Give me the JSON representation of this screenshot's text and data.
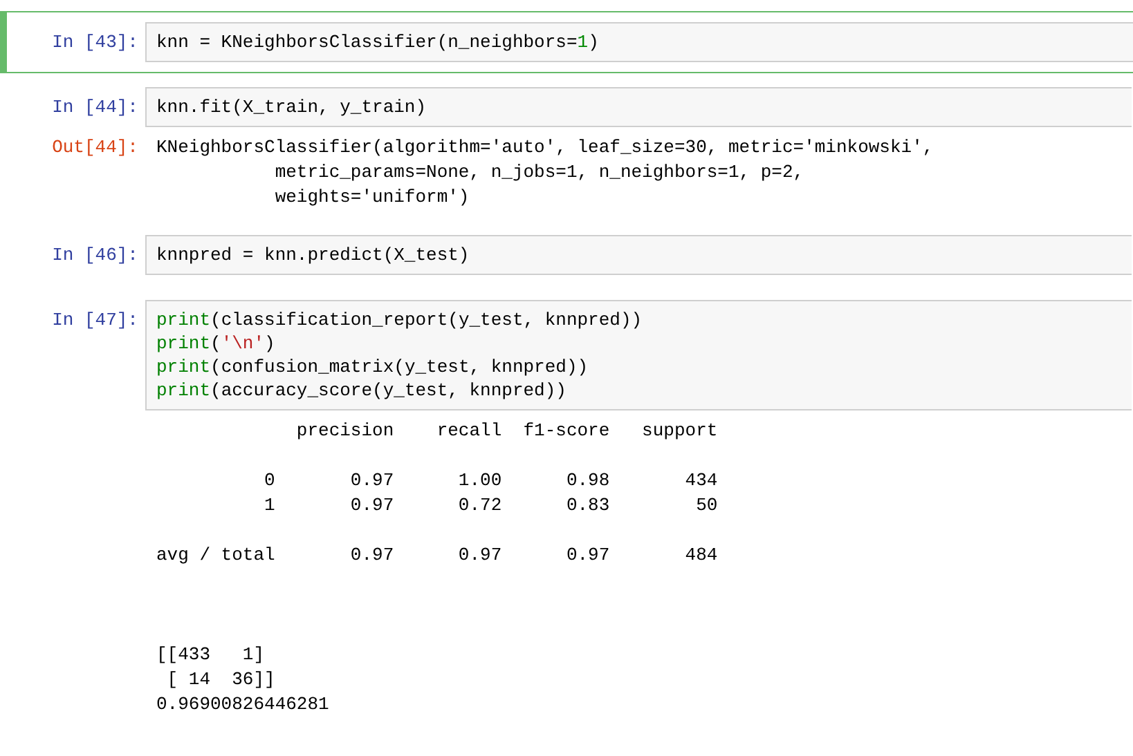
{
  "cells": [
    {
      "selected": true,
      "prompt": "In [43]:",
      "input": [
        [
          {
            "kind": "plain",
            "text": "knn = KNeighborsClassifier(n_neighbors="
          },
          {
            "kind": "number",
            "text": "1"
          },
          {
            "kind": "plain",
            "text": ")"
          }
        ]
      ]
    },
    {
      "selected": false,
      "prompt": "In [44]:",
      "input": [
        [
          {
            "kind": "plain",
            "text": "knn.fit(X_train, y_train)"
          }
        ]
      ],
      "output": {
        "prompt": "Out[44]:",
        "text": "KNeighborsClassifier(algorithm='auto', leaf_size=30, metric='minkowski',\n           metric_params=None, n_jobs=1, n_neighbors=1, p=2,\n           weights='uniform')"
      }
    },
    {
      "selected": false,
      "prompt": "In [46]:",
      "input": [
        [
          {
            "kind": "plain",
            "text": "knnpred = knn.predict(X_test)"
          }
        ]
      ]
    },
    {
      "selected": false,
      "prompt": "In [47]:",
      "input": [
        [
          {
            "kind": "builtin",
            "text": "print"
          },
          {
            "kind": "plain",
            "text": "(classification_report(y_test, knnpred))"
          }
        ],
        [
          {
            "kind": "builtin",
            "text": "print"
          },
          {
            "kind": "plain",
            "text": "("
          },
          {
            "kind": "string",
            "text": "'\\n'"
          },
          {
            "kind": "plain",
            "text": ")"
          }
        ],
        [
          {
            "kind": "builtin",
            "text": "print"
          },
          {
            "kind": "plain",
            "text": "(confusion_matrix(y_test, knnpred))"
          }
        ],
        [
          {
            "kind": "builtin",
            "text": "print"
          },
          {
            "kind": "plain",
            "text": "(accuracy_score(y_test, knnpred))"
          }
        ]
      ],
      "output": {
        "text": "             precision    recall  f1-score   support\n\n          0       0.97      1.00      0.98       434\n          1       0.97      0.72      0.83        50\n\navg / total       0.97      0.97      0.97       484\n\n\n\n[[433   1]\n [ 14  36]]\n0.96900826446281"
      }
    }
  ]
}
